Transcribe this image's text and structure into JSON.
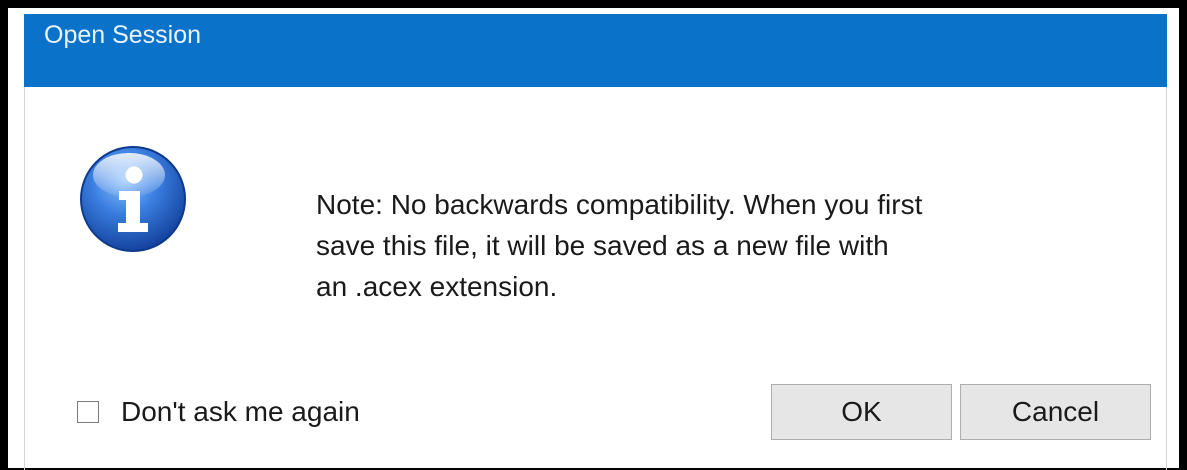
{
  "dialog": {
    "title": "Open Session",
    "icon": "info-icon",
    "message_lines": [
      "Note: No backwards compatibility. When you first",
      "save this file, it will be saved as a new file with",
      "an .acex extension."
    ],
    "checkbox": {
      "label": "Don't ask me again",
      "checked": false
    },
    "buttons": {
      "ok": "OK",
      "cancel": "Cancel"
    }
  },
  "colors": {
    "title_bar": "#0a72c9",
    "title_text": "#eaf3fc",
    "button_face": "#e6e6e6",
    "button_border": "#adadad",
    "icon_blue": "#1f5fc2"
  }
}
